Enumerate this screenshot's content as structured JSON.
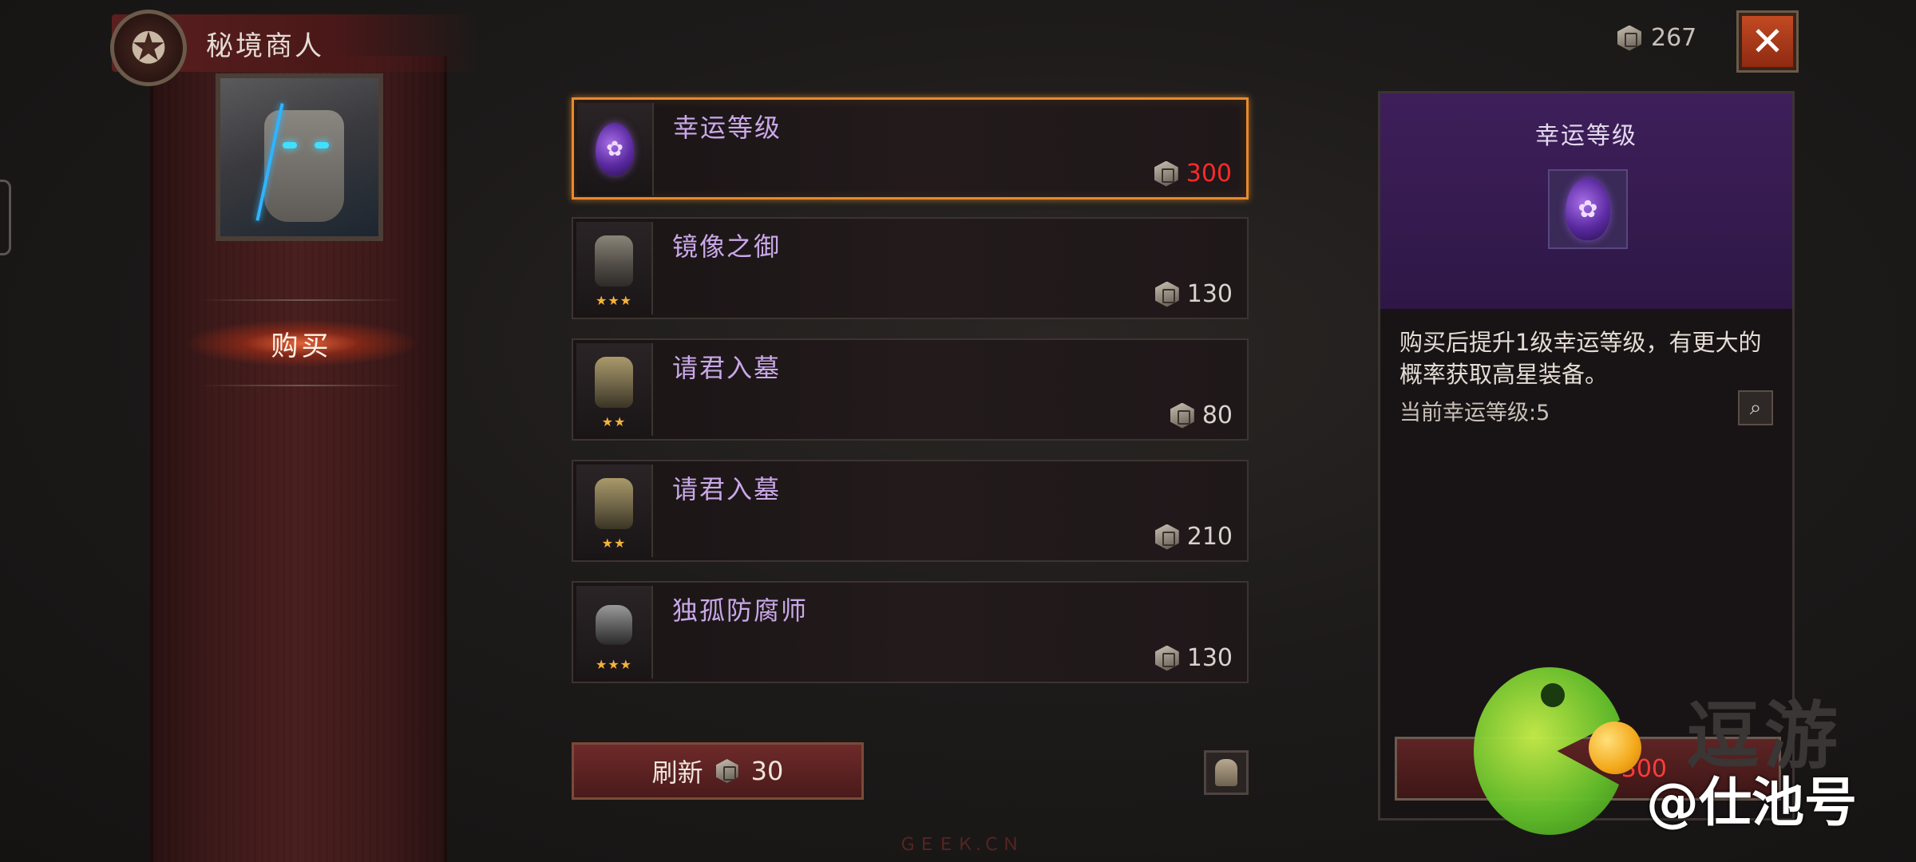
{
  "header": {
    "title": "秘境商人",
    "emblem_icon": "pentagram-icon"
  },
  "sidebar": {
    "tab_buy": "购买"
  },
  "currency": {
    "amount": "267",
    "icon": "coin-icon"
  },
  "close": {
    "label": "✕"
  },
  "items": [
    {
      "name": "幸运等级",
      "price": "300",
      "icon": "purple-gem-icon",
      "selected": true,
      "price_color": "#ff2a2a",
      "stars": ""
    },
    {
      "name": "镜像之御",
      "price": "130",
      "icon": "chest-armor-icon",
      "selected": false,
      "stars": "★★★"
    },
    {
      "name": "请君入墓",
      "price": "80",
      "icon": "chest-armor-icon",
      "selected": false,
      "stars": "★★"
    },
    {
      "name": "请君入墓",
      "price": "210",
      "icon": "chest-armor-icon",
      "selected": false,
      "stars": "★★"
    },
    {
      "name": "独孤防腐师",
      "price": "130",
      "icon": "gauntlet-icon",
      "selected": false,
      "stars": "★★★"
    }
  ],
  "refresh": {
    "label": "刷新",
    "cost": "30"
  },
  "detail": {
    "title": "幸运等级",
    "description": "购买后提升1级幸运等级，有更大的概率获取高星装备。",
    "current_level": "当前幸运等级:5",
    "buy_price": "300"
  },
  "watermark": {
    "title": "逗游",
    "handle": "@仕池号",
    "small": "ＧＥＥＫ.ＣＮ"
  }
}
